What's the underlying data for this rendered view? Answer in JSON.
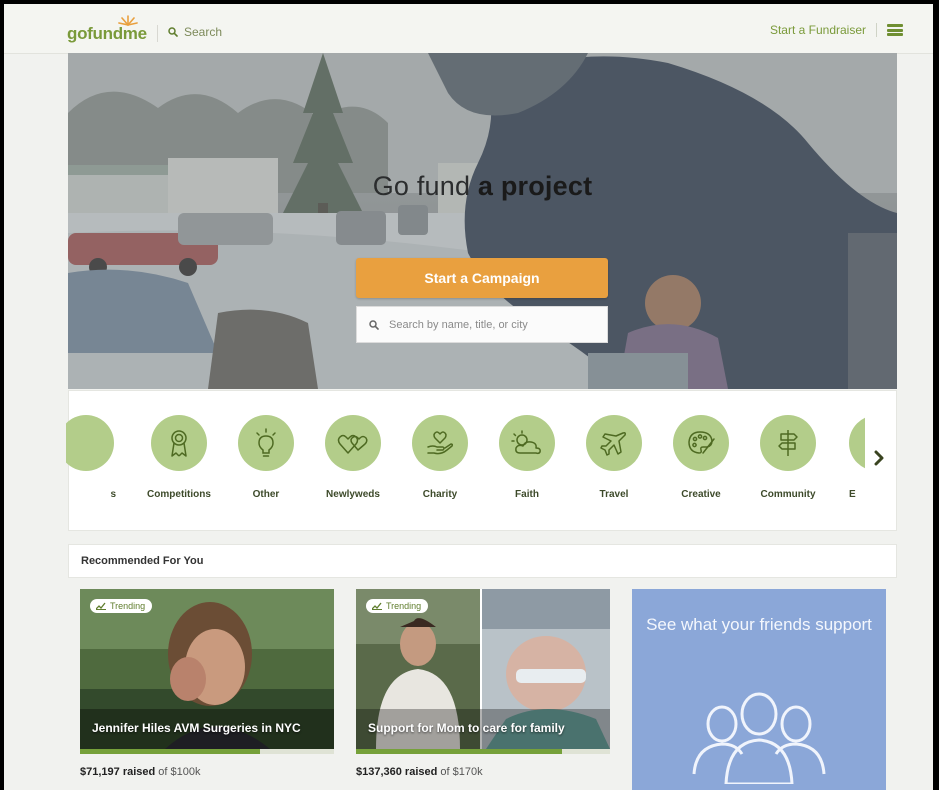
{
  "header": {
    "logo_text": "gofundme",
    "search_label": "Search",
    "start_fundraiser_label": "Start a Fundraiser"
  },
  "hero": {
    "title_light": "Go fund",
    "title_bold": "a project",
    "cta_label": "Start a Campaign",
    "search_placeholder": "Search by name, title, or city"
  },
  "categories": {
    "items": [
      {
        "label": "s",
        "icon": "partial-category-icon"
      },
      {
        "label": "Competitions",
        "icon": "ribbon-award-icon"
      },
      {
        "label": "Other",
        "icon": "lightbulb-icon"
      },
      {
        "label": "Newlyweds",
        "icon": "hearts-icon"
      },
      {
        "label": "Charity",
        "icon": "heart-in-hand-icon"
      },
      {
        "label": "Faith",
        "icon": "sun-cloud-icon"
      },
      {
        "label": "Travel",
        "icon": "airplane-icon"
      },
      {
        "label": "Creative",
        "icon": "palette-icon"
      },
      {
        "label": "Community",
        "icon": "signpost-icon"
      },
      {
        "label": "E",
        "icon": "partial-category-icon"
      }
    ]
  },
  "recommended": {
    "title": "Recommended For You",
    "cards": [
      {
        "badge": "Trending",
        "title": "Jennifer Hiles AVM Surgeries in NYC",
        "raised_amount": "$71,197 raised",
        "goal_text": "of $100k",
        "progress": 0.71
      },
      {
        "badge": "Trending",
        "title": "Support for Mom to care for family",
        "raised_amount": "$137,360 raised",
        "goal_text": "of $170k",
        "progress": 0.81
      }
    ],
    "friends_text": "See what your friends support"
  },
  "colors": {
    "brand_green": "#7a9a3a",
    "cta_orange": "#e9a03f",
    "category_green": "#b3cd8a",
    "friends_blue": "#8ba7d8"
  }
}
